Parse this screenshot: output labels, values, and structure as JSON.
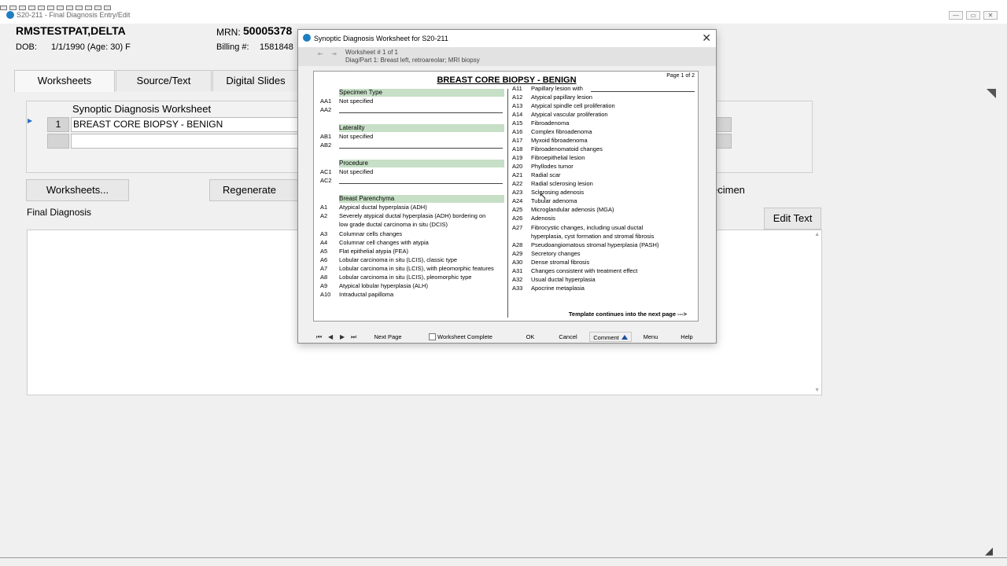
{
  "window": {
    "title": "S20-211 - Final Diagnosis Entry/Edit",
    "minimize": "—",
    "maximize": "▭",
    "close": "✕"
  },
  "patient": {
    "name": "RMSTESTPAT,DELTA",
    "dob_label": "DOB:",
    "dob_value": "1/1/1990 (Age: 30) F",
    "mrn_label": "MRN:",
    "mrn_value": "50005378",
    "billing_label": "Billing #:",
    "billing_value": "1581848"
  },
  "tabs": [
    {
      "label": "Worksheets"
    },
    {
      "label": "Source/Text"
    },
    {
      "label": "Digital Slides"
    }
  ],
  "worksheet_panel": {
    "caption": "Synoptic Diagnosis Worksheet",
    "row_number": "1",
    "row_value": "BREAST CORE BIOPSY - BENIGN"
  },
  "buttons": {
    "worksheets": "Worksheets...",
    "regenerate": "Regenerate Fina",
    "specimen": "ecimen",
    "edit_text": "Edit Text"
  },
  "final_diagnosis_label": "Final Diagnosis",
  "dialog": {
    "title": "Synoptic Diagnosis Worksheet for S20-211",
    "close": "✕",
    "ws_line1": "Worksheet # 1 of 1",
    "ws_line2": "Diag/Part 1: Breast left, retroareolar; MRI biopsy",
    "sheet_title": "BREAST CORE BIOPSY - BENIGN",
    "page_num": "Page 1 of 2",
    "sections": {
      "specimen_type": "Specimen Type",
      "laterality": "Laterality",
      "procedure": "Procedure",
      "breast_parenchyma": "Breast Parenchyma"
    },
    "left_items": [
      {
        "code": "AA1",
        "text": "Not specified"
      },
      {
        "code": "AA2",
        "text": ""
      },
      {
        "code": "AB1",
        "text": "Not specified"
      },
      {
        "code": "AB2",
        "text": ""
      },
      {
        "code": "AC1",
        "text": "Not specified"
      },
      {
        "code": "AC2",
        "text": ""
      },
      {
        "code": "A1",
        "text": "Atypical ductal hyperplasia (ADH)"
      },
      {
        "code": "A2",
        "text": "Severely atypical ductal hyperplasia (ADH) bordering on"
      },
      {
        "code": "",
        "text": "low grade ductal carcinoma in situ (DCIS)"
      },
      {
        "code": "A3",
        "text": "Columnar cells changes"
      },
      {
        "code": "A4",
        "text": "Columnar cell changes with atypia"
      },
      {
        "code": "A5",
        "text": "Flat epithelial atypia (FEA)"
      },
      {
        "code": "A6",
        "text": "Lobular carcinoma in situ (LCIS), classic type"
      },
      {
        "code": "A7",
        "text": "Lobular carcinoma in situ (LCIS), with pleomorphic features"
      },
      {
        "code": "A8",
        "text": "Lobular carcinoma in situ (LCIS), pleomorphic type"
      },
      {
        "code": "A9",
        "text": "Atypical lobular hyperplasia (ALH)"
      },
      {
        "code": "A10",
        "text": "Intraductal papilloma"
      }
    ],
    "right_items": [
      {
        "code": "A11",
        "text": "Papillary lesion with"
      },
      {
        "code": "A12",
        "text": "Atypical papillary lesion"
      },
      {
        "code": "A13",
        "text": "Atypical spindle cell proliferation"
      },
      {
        "code": "A14",
        "text": "Atypical vascular proliferation"
      },
      {
        "code": "A15",
        "text": "Fibroadenoma"
      },
      {
        "code": "A16",
        "text": "Complex fibroadenoma"
      },
      {
        "code": "A17",
        "text": "Myxoid fibroadenoma"
      },
      {
        "code": "A18",
        "text": "Fibroadenomatoid changes"
      },
      {
        "code": "A19",
        "text": "Fibroepithelial lesion"
      },
      {
        "code": "A20",
        "text": "Phyllodes tumor"
      },
      {
        "code": "A21",
        "text": "Radial scar"
      },
      {
        "code": "A22",
        "text": "Radial sclerosing lesion"
      },
      {
        "code": "A23",
        "text": "Sclerosing adenosis"
      },
      {
        "code": "A24",
        "text": "Tubular adenoma"
      },
      {
        "code": "A25",
        "text": "Microglandular adenosis (MGA)"
      },
      {
        "code": "A26",
        "text": "Adenosis"
      },
      {
        "code": "A27",
        "text": "Fibrocystic changes, including usual ductal"
      },
      {
        "code": "",
        "text": "hyperplasia, cyst formation and stromal fibrosis"
      },
      {
        "code": "A28",
        "text": "Pseudoangiomatous stromal hyperplasia (PASH)"
      },
      {
        "code": "A29",
        "text": "Secretory changes"
      },
      {
        "code": "A30",
        "text": "Dense stromal fibrosis"
      },
      {
        "code": "A31",
        "text": "Changes consistent with treatment effect"
      },
      {
        "code": "A32",
        "text": "Usual ductal hyperplasia"
      },
      {
        "code": "A33",
        "text": "Apocrine metaplasia"
      }
    ],
    "continues": "Template continues into the next page --->",
    "footer": {
      "first": "⏮",
      "prev": "◀",
      "next": "▶",
      "last": "⏭",
      "next_page": "Next Page",
      "worksheet_complete": "Worksheet Complete",
      "ok": "OK",
      "cancel": "Cancel",
      "comment": "Comment",
      "menu": "Menu",
      "help": "Help"
    }
  }
}
